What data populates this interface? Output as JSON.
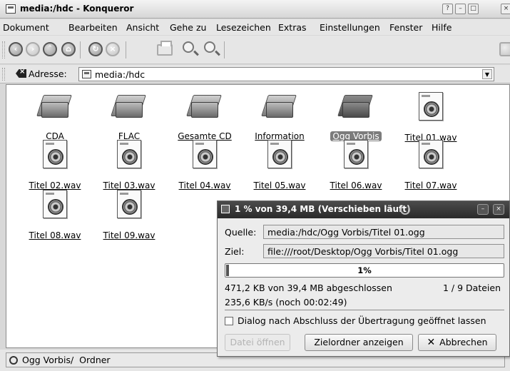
{
  "window": {
    "title": "media:/hdc - Konqueror",
    "buttons": [
      "?",
      "–",
      "□",
      "×"
    ]
  },
  "menu": [
    "Dokument",
    "Bearbeiten",
    "Ansicht",
    "Gehe zu",
    "Lesezeichen",
    "Extras",
    "Einstellungen",
    "Fenster",
    "Hilfe"
  ],
  "toolbar": {
    "icons": [
      "back-icon",
      "forward-icon",
      "up-icon",
      "home-icon",
      "reload-icon",
      "stop-icon",
      "print-icon",
      "zoom-in-icon",
      "zoom-out-icon"
    ]
  },
  "location": {
    "label": "Adresse:",
    "value": "media:/hdc"
  },
  "files": [
    {
      "name": "CDA",
      "type": "folder"
    },
    {
      "name": "FLAC",
      "type": "folder"
    },
    {
      "name": "Gesamte CD",
      "type": "folder"
    },
    {
      "name": "Information",
      "type": "folder"
    },
    {
      "name": "Ogg Vorbis",
      "type": "folder",
      "selected": true
    },
    {
      "name": "Titel 01.wav",
      "type": "wav"
    },
    {
      "name": "Titel 02.wav",
      "type": "wav"
    },
    {
      "name": "Titel 03.wav",
      "type": "wav"
    },
    {
      "name": "Titel 04.wav",
      "type": "wav"
    },
    {
      "name": "Titel 05.wav",
      "type": "wav"
    },
    {
      "name": "Titel 06.wav",
      "type": "wav"
    },
    {
      "name": "Titel 07.wav",
      "type": "wav"
    },
    {
      "name": "Titel 08.wav",
      "type": "wav"
    },
    {
      "name": "Titel 09.wav",
      "type": "wav"
    }
  ],
  "status": {
    "text": "Ogg Vorbis/  Ordner"
  },
  "dialog": {
    "title": "1 % von 39,4 MB  (Verschieben läuft)",
    "source_label": "Quelle:",
    "source_value": "media:/hdc/Ogg Vorbis/Titel 01.ogg",
    "dest_label": "Ziel:",
    "dest_value": "file:///root/Desktop/Ogg Vorbis/Titel 01.ogg",
    "progress": 1,
    "progress_text": "1%",
    "done_text": "471,2 KB von 39,4 MB abgeschlossen",
    "files_text": "1 / 9 Dateien",
    "speed_text": "235,6 KB/s (noch 00:02:49)",
    "keep_open_label": "Dialog nach Abschluss der Übertragung geöffnet lassen",
    "keep_open_checked": false,
    "open_file_label": "Datei öffnen",
    "show_folder_label": "Zielordner anzeigen",
    "cancel_label": "Abbrechen"
  }
}
